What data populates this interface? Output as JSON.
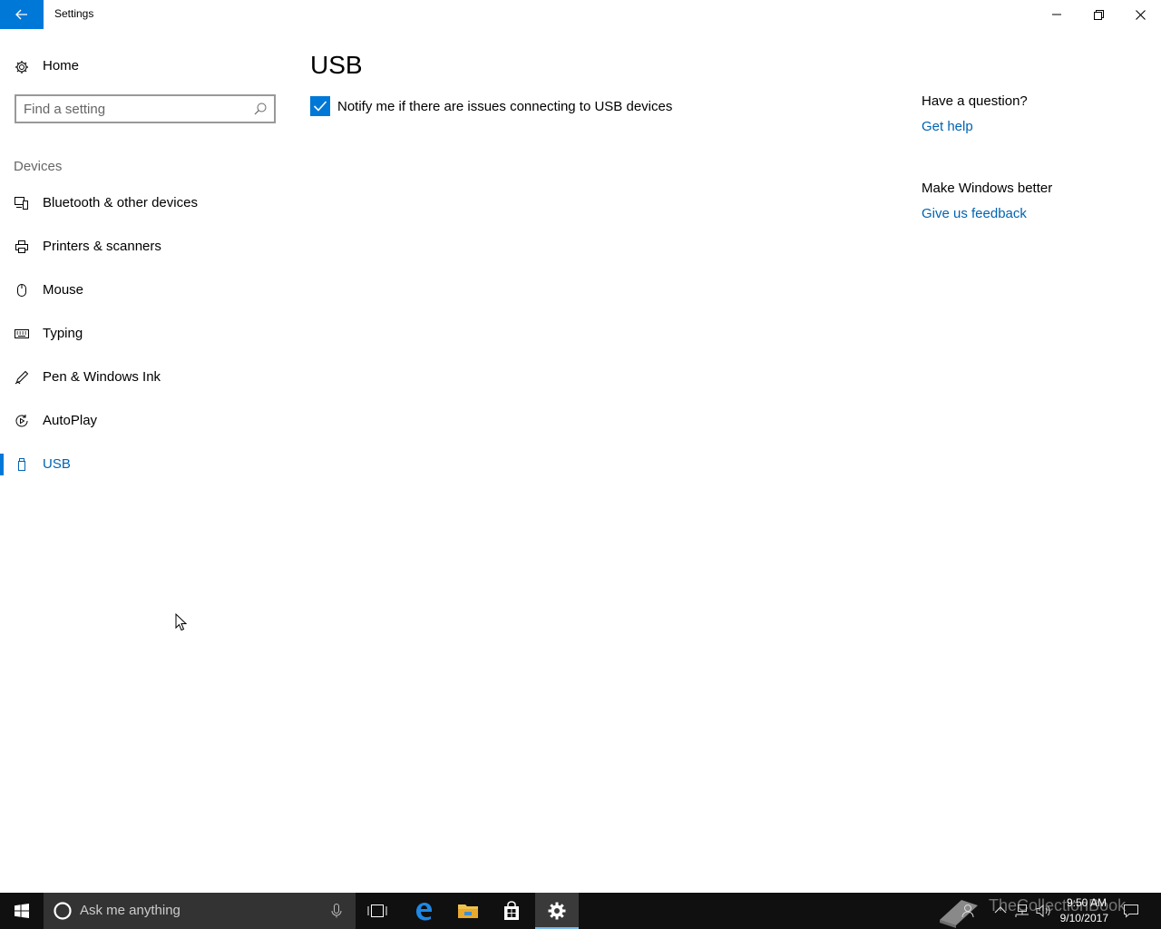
{
  "window": {
    "title": "Settings",
    "controls": {
      "minimize_icon": "minimize-icon",
      "restore_icon": "restore-icon",
      "close_icon": "close-icon"
    }
  },
  "sidebar": {
    "home_label": "Home",
    "search_placeholder": "Find a setting",
    "group_label": "Devices",
    "items": [
      {
        "label": "Bluetooth & other devices",
        "icon": "bluetooth-devices-icon"
      },
      {
        "label": "Printers & scanners",
        "icon": "printer-icon"
      },
      {
        "label": "Mouse",
        "icon": "mouse-icon"
      },
      {
        "label": "Typing",
        "icon": "keyboard-icon"
      },
      {
        "label": "Pen & Windows Ink",
        "icon": "pen-icon"
      },
      {
        "label": "AutoPlay",
        "icon": "autoplay-icon"
      },
      {
        "label": "USB",
        "icon": "usb-icon",
        "selected": true
      }
    ]
  },
  "main": {
    "title": "USB",
    "notify_checkbox": {
      "label": "Notify me if there are issues connecting to USB devices",
      "checked": true
    }
  },
  "help": {
    "question": "Have a question?",
    "get_help": "Get help",
    "improve": "Make Windows better",
    "feedback": "Give us feedback"
  },
  "taskbar": {
    "search_placeholder": "Ask me anything",
    "clock_time": "9:50 AM",
    "clock_date": "9/10/2017",
    "watermark": "TheCollectionBook"
  },
  "colors": {
    "accent": "#0078d7",
    "link": "#0063b1",
    "taskbar": "#101010"
  }
}
